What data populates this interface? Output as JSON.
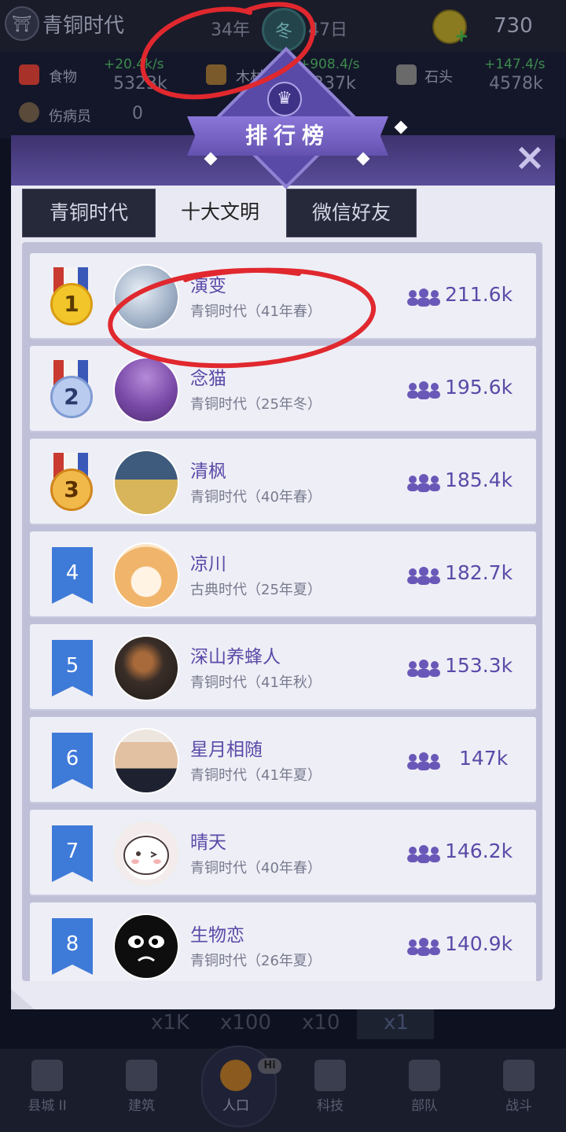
{
  "topbar": {
    "era_title": "青铜时代",
    "year": "34年",
    "season": "冬",
    "day": "47日",
    "coins": "730"
  },
  "resources": [
    {
      "label": "食物",
      "rate": "+20.4k/s",
      "value": "5323k",
      "color": "#a8322a"
    },
    {
      "label": "木材",
      "rate": "+908.4/s",
      "value": "1237k",
      "color": "#7a5a2a"
    },
    {
      "label": "石头",
      "rate": "+147.4/s",
      "value": "4578k",
      "color": "#6a6a6a"
    },
    {
      "label": "伤病员",
      "rate": "",
      "value": "0",
      "color": "#5a4a3a"
    }
  ],
  "ranking": {
    "title": "排行榜",
    "close_icon": "×",
    "tabs": [
      {
        "label": "青铜时代",
        "active": false
      },
      {
        "label": "十大文明",
        "active": true
      },
      {
        "label": "微信好友",
        "active": false
      }
    ],
    "rows": [
      {
        "rank": "1",
        "medal": "gold",
        "name": "演变",
        "era": "青铜时代（41年春）",
        "population": "211.6k",
        "avatar_color": "#a8b8cc"
      },
      {
        "rank": "2",
        "medal": "silver",
        "name": "念猫",
        "era": "青铜时代（25年冬）",
        "population": "195.6k",
        "avatar_color": "#7a4aa8"
      },
      {
        "rank": "3",
        "medal": "bronze",
        "name": "清枫",
        "era": "青铜时代（40年春）",
        "population": "185.4k",
        "avatar_color": "#4a6a8a"
      },
      {
        "rank": "4",
        "medal": "",
        "name": "凉川",
        "era": "古典时代（25年夏）",
        "population": "182.7k",
        "avatar_color": "#f2c89a"
      },
      {
        "rank": "5",
        "medal": "",
        "name": "深山养蜂人",
        "era": "青铜时代（41年秋）",
        "population": "153.3k",
        "avatar_color": "#3a2e28"
      },
      {
        "rank": "6",
        "medal": "",
        "name": "星月相随",
        "era": "青铜时代（41年夏）",
        "population": "147k",
        "avatar_color": "#e8e0d8"
      },
      {
        "rank": "7",
        "medal": "",
        "name": "晴天",
        "era": "青铜时代（40年春）",
        "population": "146.2k",
        "avatar_color": "#ffffff"
      },
      {
        "rank": "8",
        "medal": "",
        "name": "生物恋",
        "era": "青铜时代（26年夏）",
        "population": "140.9k",
        "avatar_color": "#111111"
      }
    ]
  },
  "multipliers": [
    "x1K",
    "x100",
    "x10",
    "x1"
  ],
  "nav": [
    {
      "label": "县城 II",
      "icon": "castle-icon"
    },
    {
      "label": "建筑",
      "icon": "house-icon"
    },
    {
      "label": "人口",
      "icon": "person-icon"
    },
    {
      "label": "科技",
      "icon": "book-icon"
    },
    {
      "label": "部队",
      "icon": "banner-icon"
    },
    {
      "label": "战斗",
      "icon": "swords-icon"
    }
  ],
  "nav_bubble": "Hi",
  "annotation_color": "#e0282e"
}
